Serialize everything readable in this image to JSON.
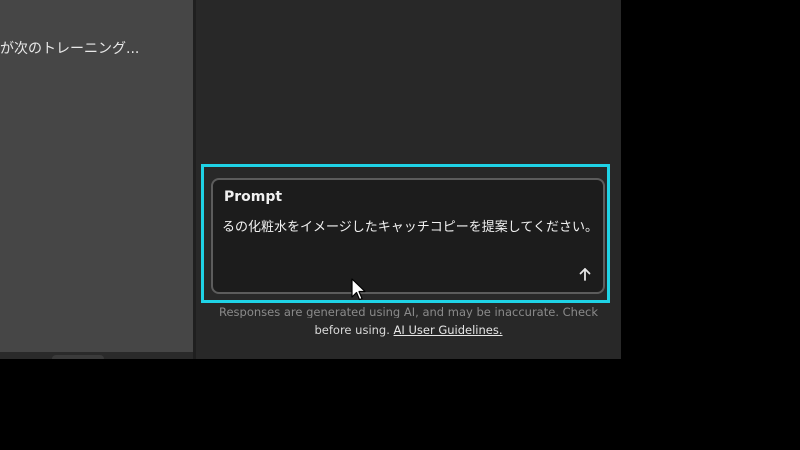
{
  "sidebar": {
    "item_text": "が次のトレーニング..."
  },
  "prompt": {
    "label": "Prompt",
    "value": "るの化粧水をイメージしたキャッチコピーを提案してください。"
  },
  "disclaimer": {
    "line1": "Responses are generated using AI, and may be inaccurate. Check",
    "line2_prefix": "before using.",
    "guidelines_link": "AI User Guidelines."
  },
  "icons": {
    "submit": "arrow-up-icon",
    "cursor": "mouse-pointer-icon"
  },
  "colors": {
    "highlight": "#1fd3e6",
    "panel_left": "#464646",
    "panel_right": "#282828",
    "prompt_bg": "#1c1c1c"
  }
}
